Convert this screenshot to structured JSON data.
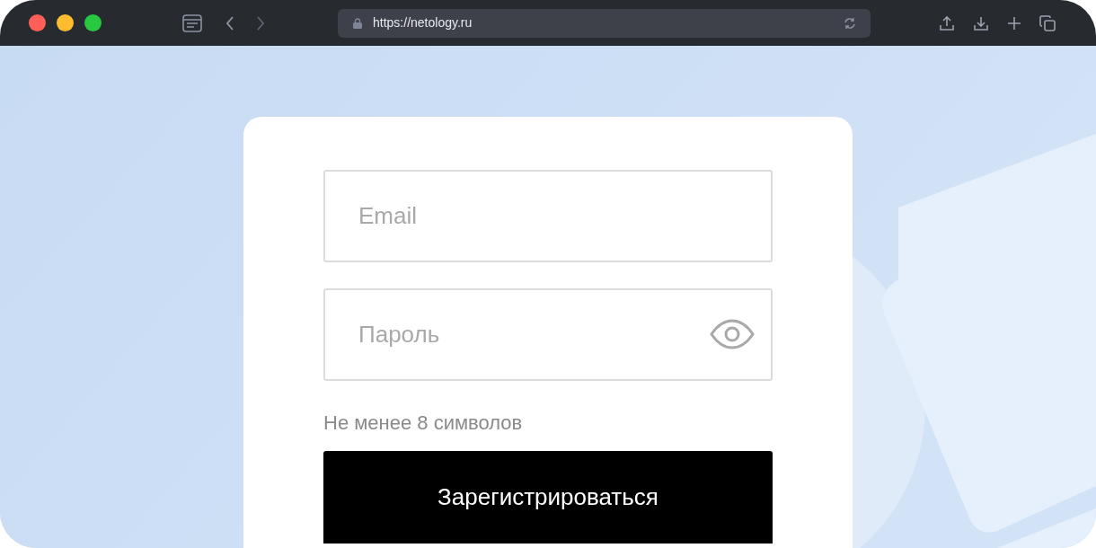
{
  "browser": {
    "url": "https://netology.ru"
  },
  "form": {
    "email": {
      "placeholder": "Email"
    },
    "password": {
      "placeholder": "Пароль"
    },
    "hint": "Не менее 8 символов",
    "submit": "Зарегистрироваться"
  }
}
